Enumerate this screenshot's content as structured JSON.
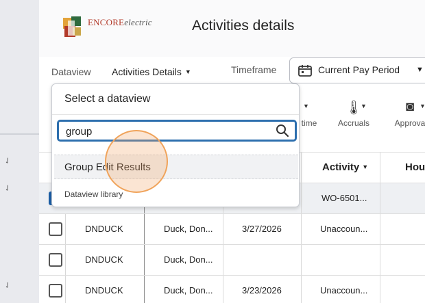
{
  "header": {
    "logo_brand": "ENCORE",
    "logo_suffix": "electric",
    "page_title": "Activities details"
  },
  "filters": {
    "dataview_label": "Dataview",
    "dataview_value": "Activities Details",
    "timeframe_label": "Timeframe",
    "timeframe_value": "Current Pay Period"
  },
  "toolbar": {
    "items": [
      {
        "label": "time",
        "icon": "calendar-clock-icon"
      },
      {
        "label": "Accruals",
        "icon": "thermometer-icon"
      },
      {
        "label": "Approva",
        "icon": "approval-clock-icon"
      }
    ]
  },
  "grid": {
    "columns": {
      "activity": "Activity",
      "hours": "Hou"
    },
    "rows": [
      {
        "selected": true,
        "code": "",
        "name": "",
        "date": "",
        "activity": "WO-6501..."
      },
      {
        "selected": false,
        "code": "DNDUCK",
        "name": "Duck, Don...",
        "date": "3/27/2026",
        "activity": "Unaccoun..."
      },
      {
        "selected": false,
        "code": "DNDUCK",
        "name": "Duck, Don...",
        "date": "",
        "activity": ""
      },
      {
        "selected": false,
        "code": "DNDUCK",
        "name": "Duck, Don...",
        "date": "3/23/2026",
        "activity": "Unaccoun..."
      }
    ]
  },
  "dataview_popup": {
    "title": "Select a dataview",
    "search_value": "group",
    "result": "Group Edit Results",
    "library_link": "Dataview library"
  },
  "colors": {
    "accent": "#2d6fae",
    "brand": "#b23a2a",
    "checkbox_checked": "#1b5fa8"
  }
}
